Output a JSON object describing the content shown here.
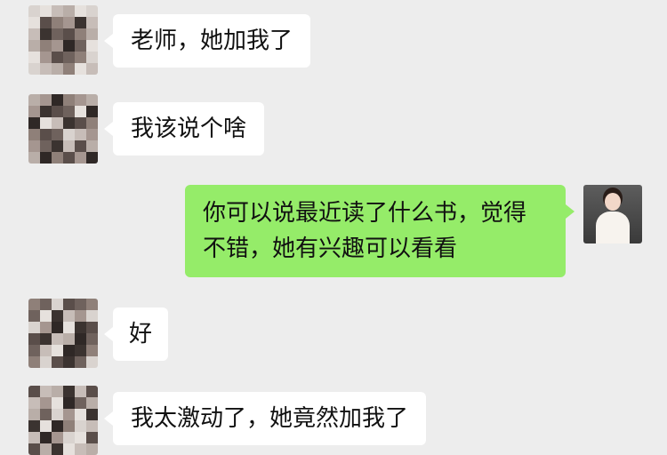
{
  "messages": [
    {
      "side": "left",
      "text": "老师，她加我了"
    },
    {
      "side": "left",
      "text": "我该说个啥"
    },
    {
      "side": "right",
      "line1": "你可以说最近读了什么书，觉得",
      "line2": "不错，她有兴趣可以看看"
    },
    {
      "side": "left",
      "text": "好"
    },
    {
      "side": "left",
      "text": "我太激动了，她竟然加我了"
    }
  ],
  "colors": {
    "background": "#ededed",
    "incoming_bubble": "#ffffff",
    "outgoing_bubble": "#95ec69"
  },
  "icons": {
    "contact_avatar": "pixelated-avatar-icon",
    "own_avatar": "woman-portrait-avatar-icon"
  }
}
